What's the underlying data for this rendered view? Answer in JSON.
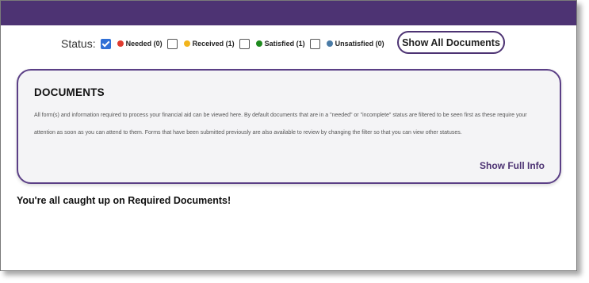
{
  "filters": {
    "status_label": "Status:",
    "items": [
      {
        "label": "Needed (0)",
        "color": "#e03b2f",
        "checked": false
      },
      {
        "label": "Received (1)",
        "color": "#f2b51c",
        "checked": false
      },
      {
        "label": "Satisfied (1)",
        "color": "#1e8a1e",
        "checked": false
      },
      {
        "label": "Unsatisfied (0)",
        "color": "#4a7ba6",
        "checked": false
      }
    ],
    "all_checked": true,
    "show_all_label": "Show All Documents"
  },
  "documents": {
    "title": "DOCUMENTS",
    "description": "All form(s) and information required to process your financial aid can be viewed here. By default documents that are in a \"needed\" or \"incomplete\" status are filtered to be seen first as these require your attention as soon as you can attend to them. Forms that have been submitted previously are also available to review by changing the filter so that you can view other statuses.",
    "show_full_label": "Show Full Info"
  },
  "message": "You're all caught up on Required Documents!",
  "colors": {
    "brand": "#4d3373",
    "card_border": "#5b3f86"
  }
}
